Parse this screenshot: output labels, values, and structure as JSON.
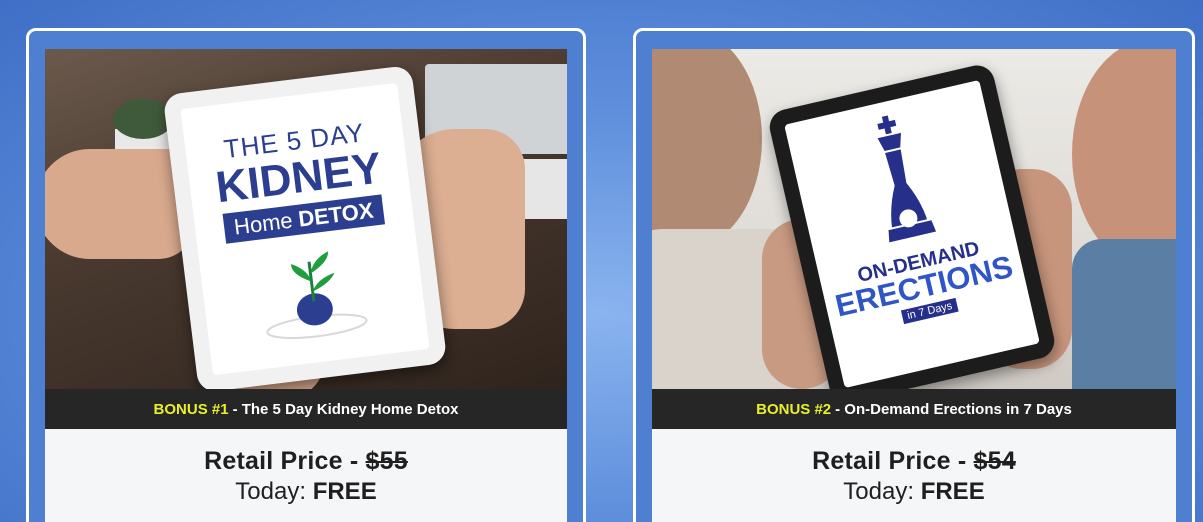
{
  "cards": [
    {
      "bonus_tag": "BONUS #1",
      "bonus_title": "- The 5 Day Kidney Home Detox",
      "retail_prefix": "Retail Price -",
      "retail_price": "$55",
      "today_prefix": "Today:",
      "today_value": "FREE",
      "cover": {
        "line1": "THE 5 DAY",
        "line2": "KIDNEY",
        "line3_a": "Home",
        "line3_b": "DETOX"
      }
    },
    {
      "bonus_tag": "BONUS #2",
      "bonus_title": "- On-Demand Erections in 7 Days",
      "retail_prefix": "Retail Price -",
      "retail_price": "$54",
      "today_prefix": "Today:",
      "today_value": "FREE",
      "cover": {
        "line1": "ON-DEMAND",
        "line2": "ERECTIONS",
        "line3": "in 7 Days"
      }
    }
  ],
  "colors": {
    "background": "#5f8fdc",
    "caption_bar": "#262626",
    "bonus_highlight": "#e7ef2b",
    "cover_blue": "#2c3e8f"
  }
}
